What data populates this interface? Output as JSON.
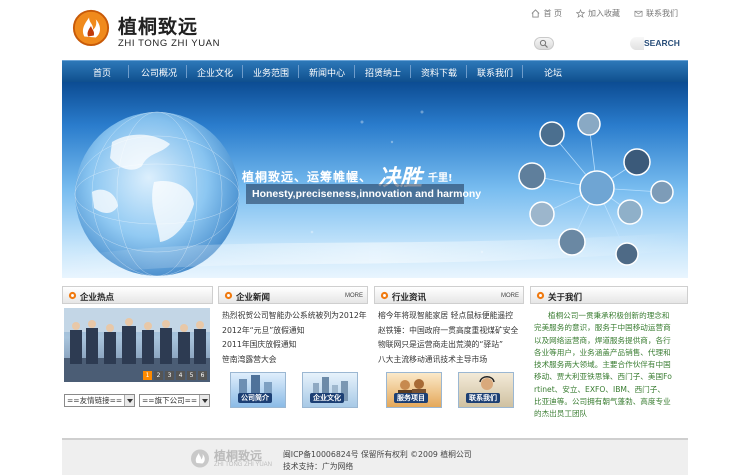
{
  "brand": {
    "name_cn": "植桐致远",
    "name_en": "ZHI TONG ZHI YUAN"
  },
  "toplinks": [
    {
      "label": "首 页",
      "icon": "home-icon"
    },
    {
      "label": "加入收藏",
      "icon": "star-icon"
    },
    {
      "label": "联系我们",
      "icon": "mail-icon"
    }
  ],
  "search": {
    "button_label": "SEARCH",
    "value": ""
  },
  "nav": [
    "首页",
    "公司概况",
    "企业文化",
    "业务范围",
    "新闻中心",
    "招贤纳士",
    "资料下载",
    "联系我们",
    "论坛"
  ],
  "banner": {
    "slogan_part1": "植桐致远、运筹帷幄、",
    "slogan_script": "决胜",
    "slogan_part2": "千里!",
    "tagline": "Honesty,preciseness,innovation and harmony"
  },
  "hot": {
    "title": "企业热点",
    "pager": [
      "1",
      "2",
      "3",
      "4",
      "5",
      "6"
    ],
    "active_page": "1",
    "select_left": "==友情链接==",
    "select_right": "==旗下公司=="
  },
  "news": {
    "title": "企业新闻",
    "more": "MORE",
    "items": [
      "热烈祝贺公司智能办公系统被列为2012年",
      "2012年“元旦”放假通知",
      "2011年国庆放假通知",
      "笹南湾露营大会"
    ],
    "thumbs": [
      "公司简介",
      "企业文化"
    ]
  },
  "industry": {
    "title": "行业资讯",
    "more": "MORE",
    "items": [
      "榕今年将现智能家居  轻点鼠标便能遥控",
      "赵铁锤：中国政府一贯高度重视煤矿安全",
      "物联网只是运营商走出荒漠的“驿站”",
      "八大主流移动通讯技术主导市场"
    ],
    "thumbs": [
      "服务项目",
      "联系我们"
    ]
  },
  "about": {
    "title": "关于我们",
    "text": "植桐公司一贯秉承积极创新的理念和完美服务的意识，服务于中国移动运营商以及网络运营商，焊道服务提供商，各行各业等用户，业务涵盖产品销售、代理和技术服务两大领域。主要合作伙伴有中国移动、贾大利亚铁思锋、西门子、美国Fortinet、安立、EXFO、IBM、西门子、比亚迪等。公司拥有朝气蓬勃、高度专业的杰出员工团队"
  },
  "footer": {
    "line1": "闽ICP备10006824号    保留所有权利  ©2009  植桐公司",
    "line2": "技术支持：广为网络"
  },
  "colors": {
    "nav": "#1a5d9e",
    "accent_orange": "#f07a10",
    "about_text": "#3a7d32"
  }
}
